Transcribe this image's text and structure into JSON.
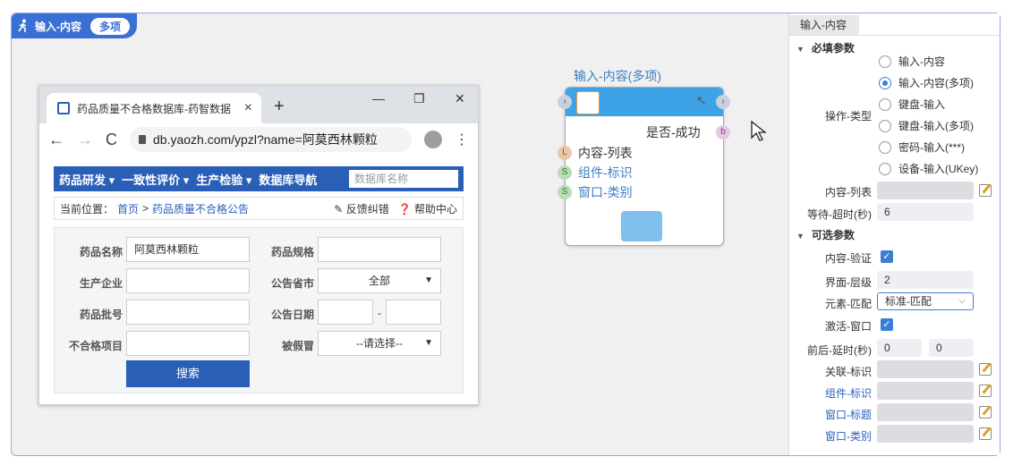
{
  "badge": {
    "title": "输入-内容",
    "pill": "多项"
  },
  "browser": {
    "tab_title": "药品质量不合格数据库-药智数据",
    "tab_close": "×",
    "new_tab": "+",
    "win_min": "—",
    "win_restore": "❐",
    "win_close": "✕",
    "back": "←",
    "forward": "→",
    "reload": "C",
    "url": "db.yaozh.com/ypzl?name=阿莫西林颗粒",
    "menu": "⋮",
    "nav": [
      "药品研发 ▾",
      "一致性评价 ▾",
      "生产检验 ▾",
      "数据库导航"
    ],
    "db_search_placeholder": "数据库名称",
    "crumb_prefix": "当前位置：",
    "crumb_home": "首页",
    "crumb_sep": ">",
    "crumb_page": "药品质量不合格公告",
    "feedback": "反馈纠错",
    "help": "帮助中心",
    "form": {
      "drug_name_label": "药品名称",
      "drug_name_value": "阿莫西林颗粒",
      "spec_label": "药品规格",
      "maker_label": "生产企业",
      "province_label": "公告省市",
      "province_value": "全部",
      "approval_label": "药品批号",
      "date_label": "公告日期",
      "date_sep": "-",
      "fail_label": "不合格项目",
      "fake_label": "被假冒",
      "fake_value": "--请选择--",
      "search_button": "搜索"
    }
  },
  "node": {
    "title": "输入-内容(多项)",
    "output_label": "是否-成功",
    "output_port": "b",
    "inputs": [
      {
        "port": "L",
        "label": "内容-列表"
      },
      {
        "port": "S",
        "label": "组件-标识"
      },
      {
        "port": "S",
        "label": "窗口-类别"
      }
    ]
  },
  "panel": {
    "tab": "输入-内容",
    "required_title": "必填参数",
    "op_type_label": "操作-类型",
    "op_types": [
      "输入-内容",
      "输入-内容(多项)",
      "键盘-输入",
      "键盘-输入(多项)",
      "密码-输入(***)",
      "设备-输入(UKey)"
    ],
    "op_type_selected": 1,
    "content_list_label": "内容-列表",
    "timeout_label": "等待-超时(秒)",
    "timeout_value": "6",
    "optional_title": "可选参数",
    "verify_label": "内容-验证",
    "layer_label": "界面-层级",
    "layer_value": "2",
    "match_label": "元素-匹配",
    "match_value": "标准-匹配",
    "activate_label": "激活-窗口",
    "delay_label": "前后-延时(秒)",
    "delay_before": "0",
    "delay_after": "0",
    "assoc_label": "关联-标识",
    "comp_label": "组件-标识",
    "win_title_label": "窗口-标题",
    "win_class_label": "窗口-类别"
  }
}
